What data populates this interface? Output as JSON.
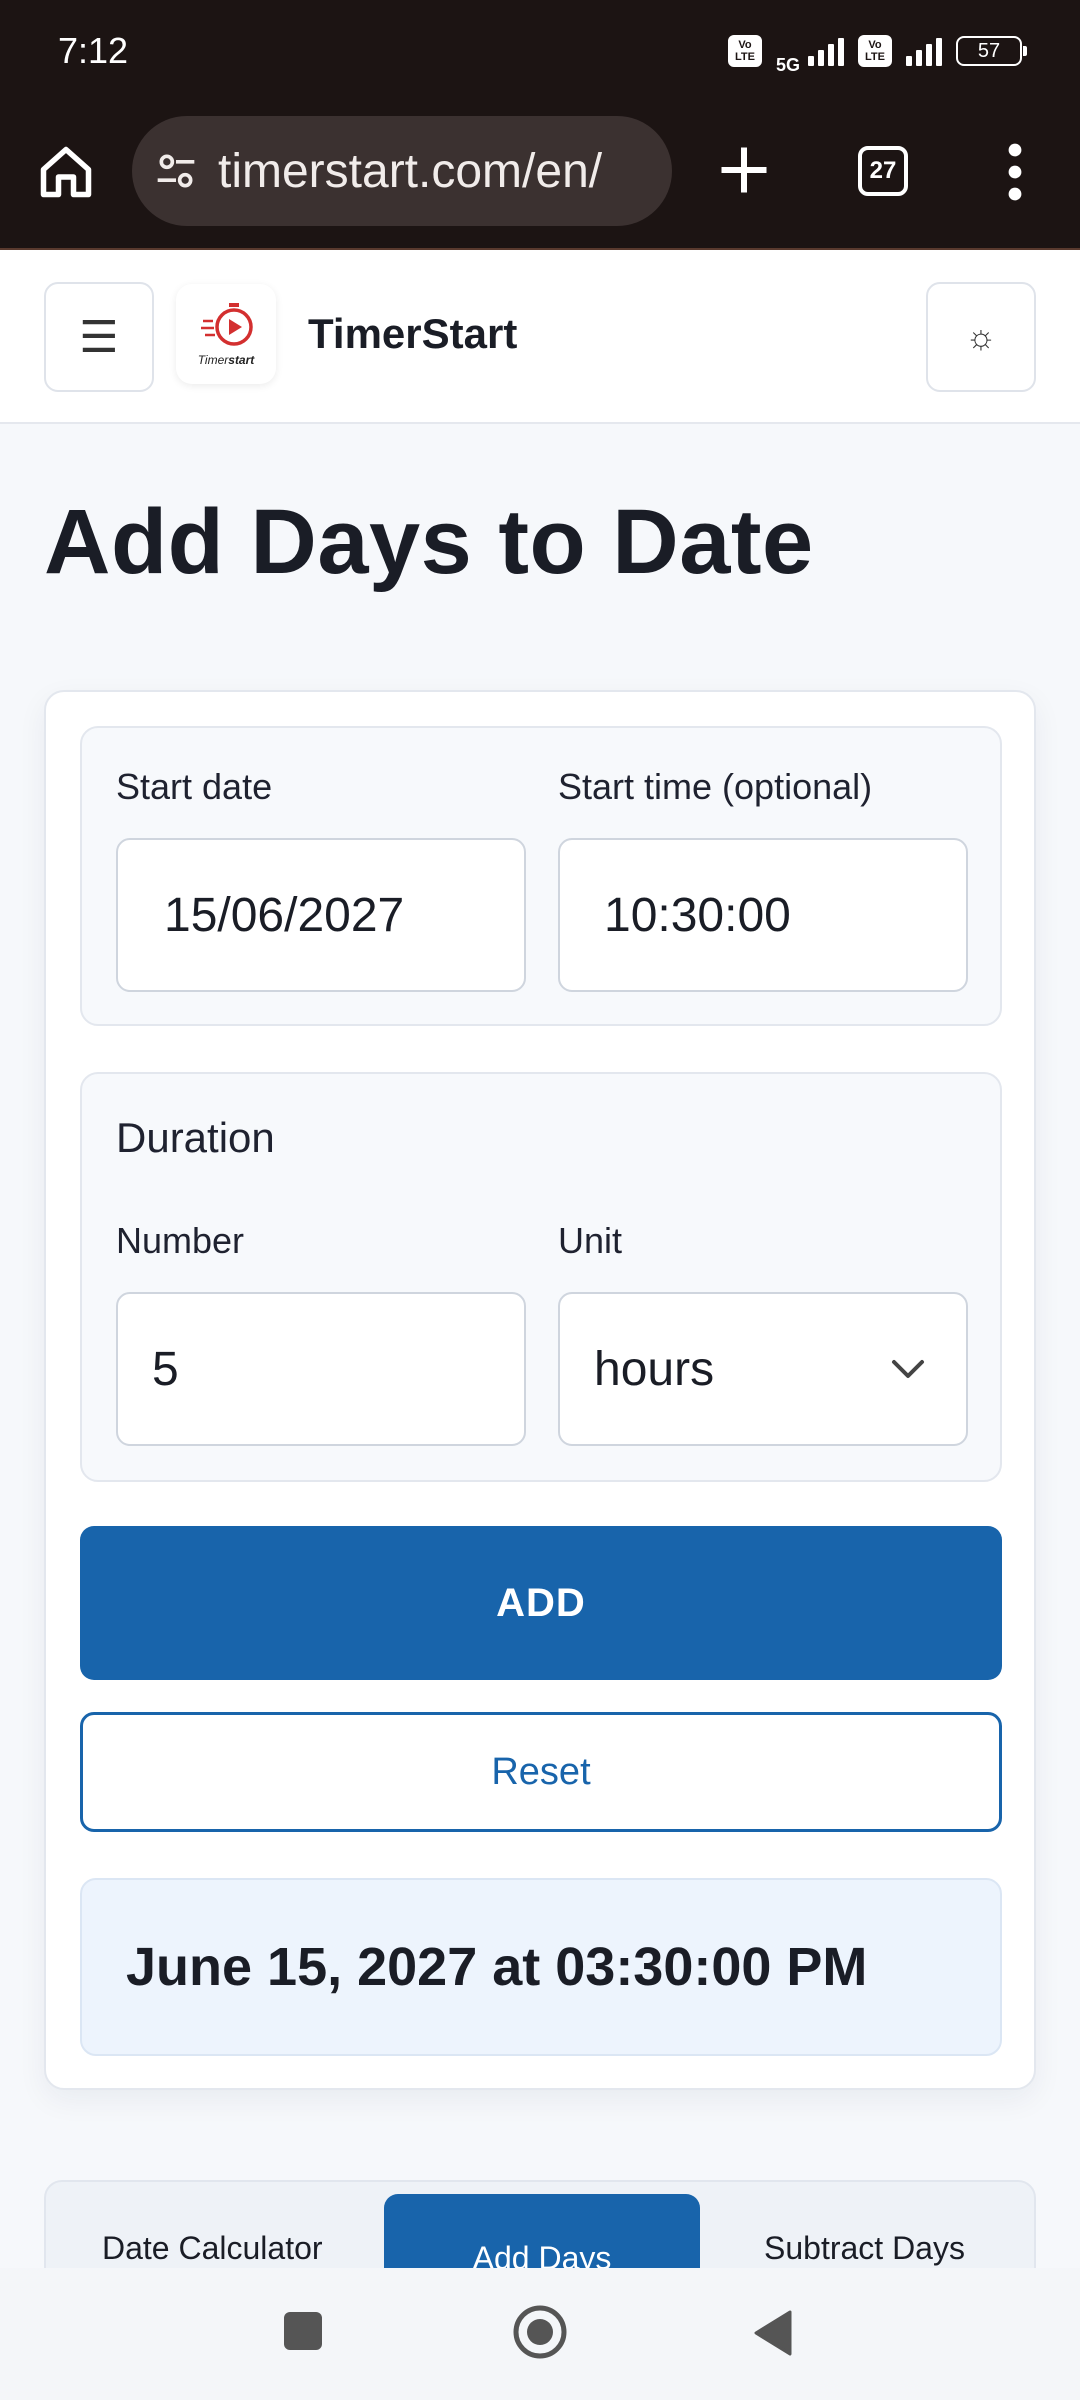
{
  "status_bar": {
    "time": "7:12",
    "network": "5G",
    "volte_label": "Vo LTE",
    "battery": "57"
  },
  "browser": {
    "url": "timerstart.com/en/",
    "tab_count": "27"
  },
  "header": {
    "menu_icon": "☰",
    "brand": "TimerStart",
    "logo_word_plain": "Timer",
    "logo_word_bold": "start",
    "theme_icon": "☼"
  },
  "page": {
    "title": "Add Days to Date"
  },
  "start": {
    "date_label": "Start date",
    "date_value": "15/06/2027",
    "time_label": "Start time (optional)",
    "time_value": "10:30:00"
  },
  "duration": {
    "title": "Duration",
    "number_label": "Number",
    "number_value": "5",
    "unit_label": "Unit",
    "unit_value": "hours"
  },
  "actions": {
    "add_label": "ADD",
    "reset_label": "Reset"
  },
  "result": {
    "text": "June 15, 2027 at 03:30:00 PM"
  },
  "tabs": {
    "items": [
      "Date Calculator",
      "Add Days",
      "Subtract Days"
    ],
    "active": "Add Days"
  },
  "colors": {
    "primary": "#1864ab",
    "browser_bg": "#1c1413",
    "page_bg": "#f6f8fb",
    "result_bg": "#edf4fd"
  }
}
